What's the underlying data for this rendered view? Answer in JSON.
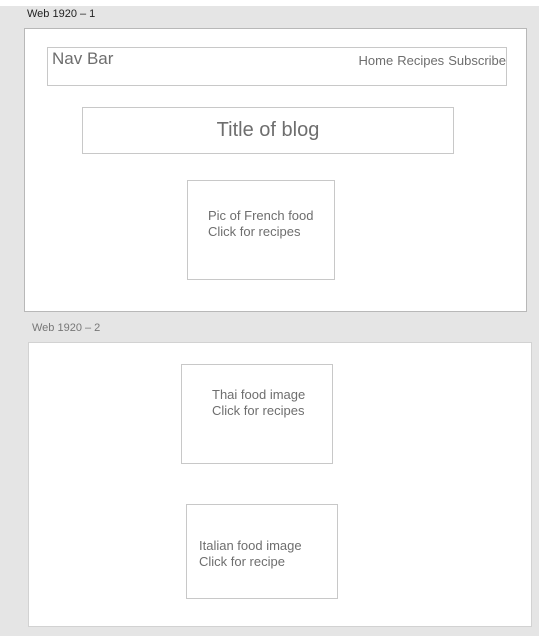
{
  "artboards": [
    {
      "label": "Web 1920 – 1",
      "navbar": {
        "title": "Nav Bar",
        "links": [
          "Home",
          "Recipes",
          "Subscribe"
        ]
      },
      "blog_title": "Title of blog",
      "french_card": {
        "lines": [
          "Pic of French food",
          "Click for recipes"
        ]
      }
    },
    {
      "label": "Web 1920 – 2",
      "thai_card": {
        "lines": [
          "Thai food image",
          "Click for recipes"
        ]
      },
      "italian_card": {
        "lines": [
          "Italian food image",
          "Click for recipe"
        ]
      }
    }
  ]
}
